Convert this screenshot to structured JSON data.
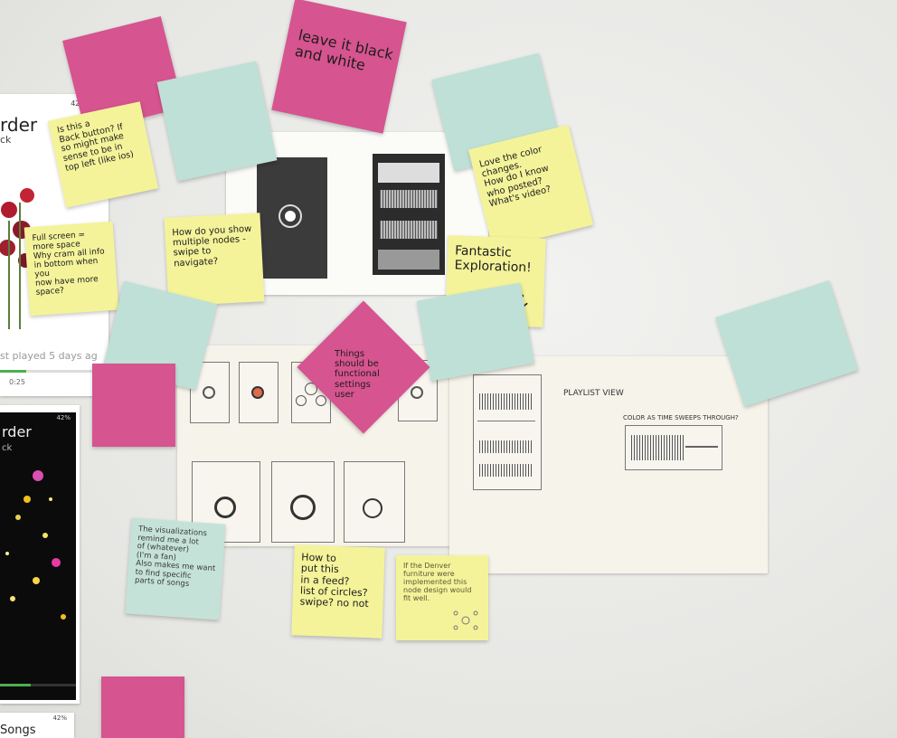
{
  "phone_top": {
    "status_battery": "42%",
    "title_fragment": "rder",
    "subtitle_fragment": "ck",
    "last_played": "st played 5 days ag",
    "time": "0:25"
  },
  "phone_mid": {
    "status_battery": "42%",
    "title_fragment": "rder",
    "subtitle_fragment": "ck"
  },
  "phone_bottom": {
    "status_battery": "42%",
    "title_fragment": "Songs"
  },
  "notes": {
    "pink_top": "leave it black\nand white",
    "yellow_left": "Is this a\nBack button? If\nso might make\nsense to be in\ntop left (like ios)",
    "yellow_fullscreen": "Full screen =\nmore space\nWhy cram all info\nin bottom when you\nnow have more space?",
    "yellow_multiple": "How do you show\nmultiple nodes -\nswipe to navigate?",
    "yellow_color": "Love the color\nchanges.\nHow do I know\nwho posted?\nWhat's video?",
    "yellow_fantastic": "Fantastic\nExploration!",
    "pink_center": "Things\nshould be\nfunctional\nsettings\nuser",
    "yellow_viz": "The visualizations\nremind me a lot\nof (whatever)\n(I'm a fan)\nAlso makes me want\nto find specific\nparts of songs",
    "yellow_feed": "How to\nput this\nin a feed?\nlist of circles?\nswipe? no not",
    "yellow_denver": "If the Denver\nfurniture were\nimplemented this\nnode design would\nfit well."
  },
  "sketch": {
    "playlist_label": "PLAYLIST VIEW",
    "caption_top": "COLOR AS TIME SWEEPS THROUGH?"
  }
}
